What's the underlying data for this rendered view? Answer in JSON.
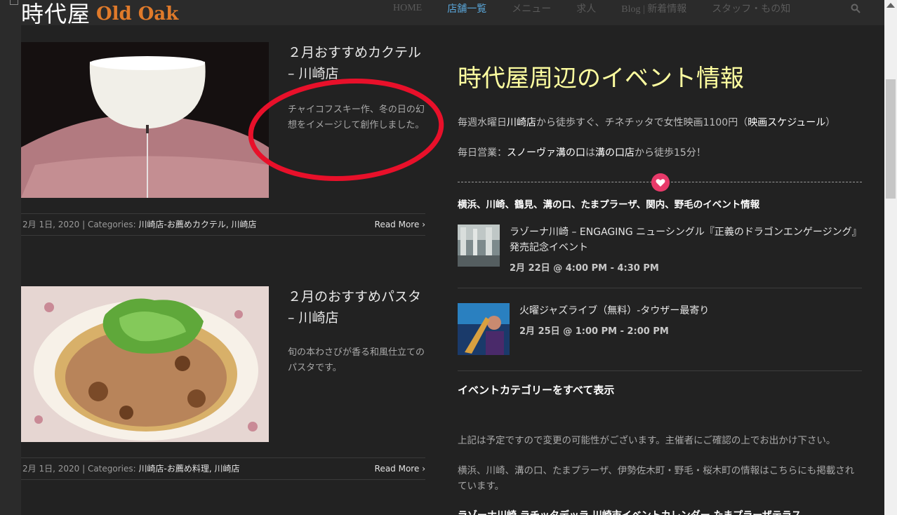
{
  "header": {
    "logo_kanji": "時代屋",
    "logo_en": "Old Oak",
    "nav": [
      "HOME",
      "店舗一覧",
      "メニュー",
      "求人",
      "Blog | 新着情報",
      "スタッフ・もの知"
    ]
  },
  "posts": [
    {
      "title": "２月おすすめカクテル – 川崎店",
      "excerpt": "チャイコフスキー作、冬の日の幻想をイメージして創作しました。",
      "date": "2月 1日, 2020",
      "categories_label": "Categories:",
      "categories": "川崎店-お薦めカクテル, 川崎店",
      "read_more": "Read More"
    },
    {
      "title": "２月のおすすめパスタ – 川崎店",
      "excerpt": "旬の本わさびが香る和風仕立てのパスタです。",
      "date": "2月 1日, 2020",
      "categories_label": "Categories:",
      "categories": "川崎店-お薦め料理, 川崎店",
      "read_more": "Read More"
    }
  ],
  "sidebar": {
    "heading": "時代屋周辺のイベント情報",
    "line1_pre": "毎週水曜日",
    "line1_link1": "川崎店",
    "line1_mid": "から徒歩すぐ、チネチッタで女性映画1100円（",
    "line1_link2": "映画スケジュール",
    "line1_post": "）",
    "line2_pre": "毎日営業：",
    "line2_link1": "スノーヴァ溝の口",
    "line2_mid": "は",
    "line2_link2": "溝の口店",
    "line2_post": "から徒歩15分！",
    "region_title": "横浜、川崎、鶴見、溝の口、たまプラーザ、関内、野毛のイベント情報",
    "events": [
      {
        "title": "ラゾーナ川崎 – ENGAGING ニューシングル『正義のドラゴンエンゲージング』発売記念イベント",
        "date": "2月 22日 @ 4:00 PM - 4:30 PM"
      },
      {
        "title": "火曜ジャズライブ（無料）-タウザー最寄り",
        "date": "2月 25日 @ 1:00 PM - 2:00 PM"
      }
    ],
    "all_categories": "イベントカテゴリーをすべて表示",
    "note1": "上記は予定ですので変更の可能性がございます。主催者にご確認の上でお出かけ下さい。",
    "note2": "横浜、川崎、溝の口、たまプラーザ、伊勢佐木町・野毛・桜木町の情報はこちらにも掲載されています。",
    "bottom_links": "ラゾーナ川崎  ラチッタデッラ  川崎市イベントカレンダー  たまプラーザテラス"
  },
  "colors": {
    "accent_nav": "#5aa6d9",
    "heading_yellow": "#ffffa0",
    "heart_pink": "#e83a6a",
    "annotation_red": "#e8102a",
    "logo_orange": "#e07a2a"
  }
}
